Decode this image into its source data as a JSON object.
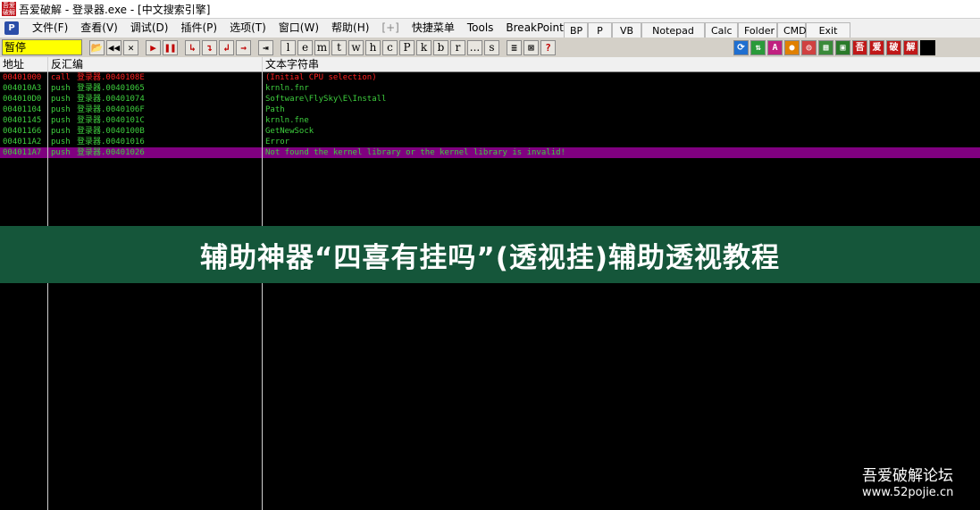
{
  "window": {
    "icon_text": "吾爱破解",
    "title": "吾爱破解 - 登录器.exe - [中文搜索引擎]"
  },
  "menu": {
    "items": [
      "文件(F)",
      "查看(V)",
      "调试(D)",
      "插件(P)",
      "选项(T)",
      "窗口(W)",
      "帮助(H)",
      "[+]",
      "快捷菜单",
      "Tools",
      "BreakPoint->"
    ],
    "buttons": [
      "BP",
      "P",
      "VB",
      "Notepad",
      "Calc",
      "Folder",
      "CMD",
      "Exit"
    ]
  },
  "toolbar": {
    "status": "暂停",
    "debug_buttons": [
      "📂",
      "◀◀",
      "✕",
      "▶",
      "❚❚",
      "↳",
      "↴",
      "↲",
      "→",
      "⇥"
    ],
    "letter_buttons": [
      "l",
      "e",
      "m",
      "t",
      "w",
      "h",
      "c",
      "P",
      "k",
      "b",
      "r",
      "...",
      "s"
    ],
    "right_buttons": [
      "≡",
      "⊠",
      "?"
    ],
    "plugin_buttons": [
      "⟳",
      "⇅",
      "A",
      "●",
      "◎",
      "▦",
      "▣",
      "吾",
      "爱",
      "破",
      "解",
      ""
    ]
  },
  "columns": {
    "address": "地址",
    "disasm": "反汇编",
    "text": "文本字符串"
  },
  "rows": [
    {
      "addr": "00401000",
      "op": "call",
      "arg": "登录器.0040108E",
      "text": "(Initial CPU selection)"
    },
    {
      "addr": "004010A3",
      "op": "push",
      "arg": "登录器.00401065",
      "text": "krnln.fnr"
    },
    {
      "addr": "004010D0",
      "op": "push",
      "arg": "登录器.00401074",
      "text": "Software\\FlySky\\E\\Install"
    },
    {
      "addr": "00401104",
      "op": "push",
      "arg": "登录器.0040106F",
      "text": "Path"
    },
    {
      "addr": "00401145",
      "op": "push",
      "arg": "登录器.0040101C",
      "text": "krnln.fne"
    },
    {
      "addr": "00401166",
      "op": "push",
      "arg": "登录器.0040100B",
      "text": "GetNewSock"
    },
    {
      "addr": "004011A2",
      "op": "push",
      "arg": "登录器.00401016",
      "text": "Error"
    },
    {
      "addr": "004011A7",
      "op": "push",
      "arg": "登录器.00401026",
      "text": "Not found the kernel library or the kernel library is invalid!"
    }
  ],
  "banner": {
    "text": "辅助神器“四喜有挂吗”(透视挂)辅助透视教程"
  },
  "watermark": {
    "name": "吾爱破解论坛",
    "url": "www.52pojie.cn"
  },
  "colors": {
    "selection": "#800080",
    "listing_text": "#3ecf3e",
    "first_row_text": "#ff2020",
    "banner_bg": "#15563a",
    "status_bg": "#ffff00"
  }
}
